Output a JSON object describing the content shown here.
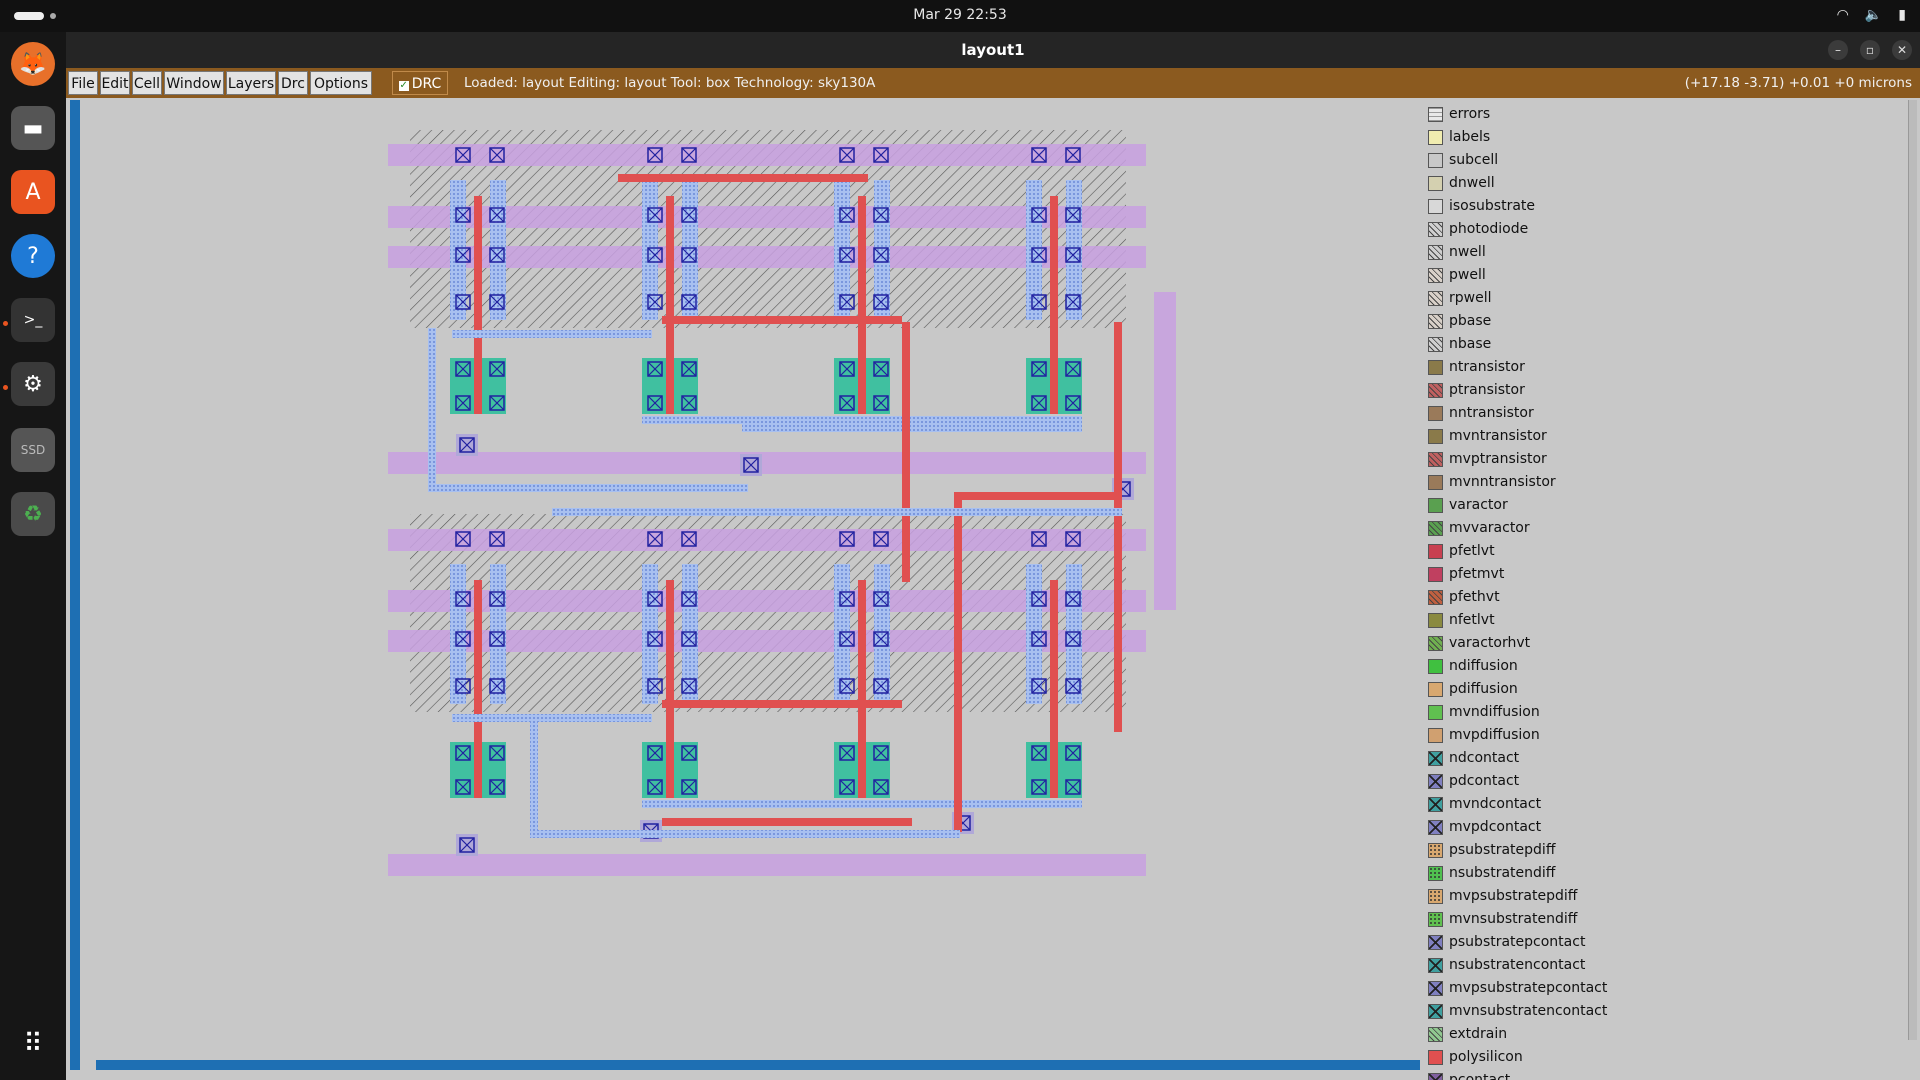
{
  "system": {
    "clock": "Mar 29  22:53"
  },
  "dock": {
    "apps": [
      {
        "name": "firefox",
        "glyph": "🦊"
      },
      {
        "name": "files",
        "glyph": "▬"
      },
      {
        "name": "app-center",
        "glyph": "A"
      },
      {
        "name": "help",
        "glyph": "?"
      },
      {
        "name": "terminal",
        "glyph": ">_"
      },
      {
        "name": "settings",
        "glyph": "⚙"
      },
      {
        "name": "ssd",
        "glyph": "SSD"
      },
      {
        "name": "trash",
        "glyph": "♻"
      },
      {
        "name": "show-apps",
        "glyph": "⠿"
      }
    ]
  },
  "window": {
    "title": "layout1"
  },
  "menu": {
    "file": "File",
    "edit": "Edit",
    "cell": "Cell",
    "window": "Window",
    "layers": "Layers",
    "drc": "Drc",
    "options": "Options",
    "drc_toggle": "DRC"
  },
  "status_text": "Loaded: layout Editing: layout Tool: box  Technology: sky130A",
  "coords_text": "(+17.18 -3.71) +0.01 +0 microns",
  "legend": [
    {
      "name": "errors",
      "color": "#e8e8e8",
      "pattern": "grid"
    },
    {
      "name": "labels",
      "color": "#f0ecb0",
      "pattern": "solid"
    },
    {
      "name": "subcell",
      "color": "#d8d8d8",
      "pattern": "outline"
    },
    {
      "name": "dnwell",
      "color": "#d4d0b0",
      "pattern": "solid"
    },
    {
      "name": "isosubstrate",
      "color": "#d8d8d8",
      "pattern": "solid"
    },
    {
      "name": "photodiode",
      "color": "#d0d0d0",
      "pattern": "hatch"
    },
    {
      "name": "nwell",
      "color": "#d0d0d0",
      "pattern": "hatch"
    },
    {
      "name": "pwell",
      "color": "#d8d0c8",
      "pattern": "hatch"
    },
    {
      "name": "rpwell",
      "color": "#d8d0c8",
      "pattern": "hatch"
    },
    {
      "name": "pbase",
      "color": "#d8d0c8",
      "pattern": "hatch"
    },
    {
      "name": "nbase",
      "color": "#d0d0d0",
      "pattern": "hatch"
    },
    {
      "name": "ntransistor",
      "color": "#8a7a4a",
      "pattern": "solid"
    },
    {
      "name": "ptransistor",
      "color": "#c06060",
      "pattern": "hatch"
    },
    {
      "name": "nntransistor",
      "color": "#9a7a5a",
      "pattern": "solid"
    },
    {
      "name": "mvntransistor",
      "color": "#8a7a4a",
      "pattern": "solid"
    },
    {
      "name": "mvptransistor",
      "color": "#c06060",
      "pattern": "hatch"
    },
    {
      "name": "mvnntransistor",
      "color": "#9a7a5a",
      "pattern": "solid"
    },
    {
      "name": "varactor",
      "color": "#5aa050",
      "pattern": "solid"
    },
    {
      "name": "mvvaractor",
      "color": "#5aa050",
      "pattern": "hatch"
    },
    {
      "name": "pfetlvt",
      "color": "#c84050",
      "pattern": "solid"
    },
    {
      "name": "pfetmvt",
      "color": "#c04060",
      "pattern": "solid"
    },
    {
      "name": "pfethvt",
      "color": "#c06040",
      "pattern": "hatch"
    },
    {
      "name": "nfetlvt",
      "color": "#8a8a40",
      "pattern": "solid"
    },
    {
      "name": "varactorhvt",
      "color": "#70b050",
      "pattern": "hatch"
    },
    {
      "name": "ndiffusion",
      "color": "#40c040",
      "pattern": "solid"
    },
    {
      "name": "pdiffusion",
      "color": "#d8a870",
      "pattern": "solid"
    },
    {
      "name": "mvndiffusion",
      "color": "#60c050",
      "pattern": "solid"
    },
    {
      "name": "mvpdiffusion",
      "color": "#d0a070",
      "pattern": "solid"
    },
    {
      "name": "ndcontact",
      "color": "#40a0a0",
      "pattern": "cross"
    },
    {
      "name": "pdcontact",
      "color": "#8080c0",
      "pattern": "cross"
    },
    {
      "name": "mvndcontact",
      "color": "#40a0a0",
      "pattern": "cross"
    },
    {
      "name": "mvpdcontact",
      "color": "#8080c0",
      "pattern": "cross"
    },
    {
      "name": "psubstratepdiff",
      "color": "#d8a870",
      "pattern": "dots"
    },
    {
      "name": "nsubstratendiff",
      "color": "#50c050",
      "pattern": "dots"
    },
    {
      "name": "mvpsubstratepdiff",
      "color": "#d8a870",
      "pattern": "dots"
    },
    {
      "name": "mvnsubstratendiff",
      "color": "#60c050",
      "pattern": "dots"
    },
    {
      "name": "psubstratepcontact",
      "color": "#8080c0",
      "pattern": "cross"
    },
    {
      "name": "nsubstratencontact",
      "color": "#40a0a0",
      "pattern": "cross"
    },
    {
      "name": "mvpsubstratepcontact",
      "color": "#8080c0",
      "pattern": "cross"
    },
    {
      "name": "mvnsubstratencontact",
      "color": "#40a0a0",
      "pattern": "cross"
    },
    {
      "name": "extdrain",
      "color": "#90c890",
      "pattern": "hatch"
    },
    {
      "name": "polysilicon",
      "color": "#e05050",
      "pattern": "solid"
    },
    {
      "name": "pcontact",
      "color": "#8060a0",
      "pattern": "cross"
    }
  ],
  "colors": {
    "menu_bg": "#8b5a1f",
    "canvas_bg": "#c8c8c8",
    "metal1": "#c8a0e0",
    "local_interconnect": "#90b0f0",
    "poly": "#e05050",
    "ndiff": "#40c0a0",
    "contact": "#2020a0"
  }
}
